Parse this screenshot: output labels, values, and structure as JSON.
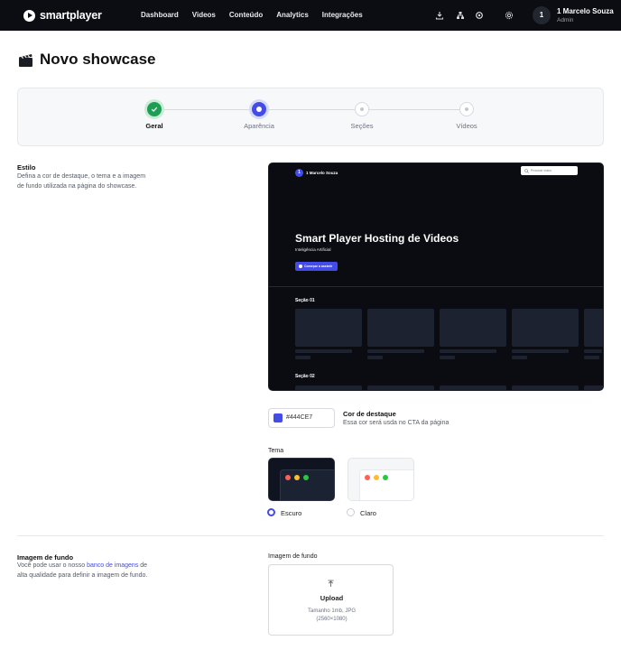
{
  "app": {
    "brand": "smartplayer",
    "nav": [
      "Dashboard",
      "Videos",
      "Conteúdo",
      "Analytics",
      "Integrações"
    ],
    "user": {
      "avatar": "1",
      "name": "1 Marcelo Souza",
      "role": "Admin"
    },
    "icons": [
      "download-icon",
      "network-icon",
      "settings-icon",
      "gear-icon"
    ]
  },
  "page": {
    "title": "Novo showcase"
  },
  "stepper": {
    "steps": [
      {
        "label": "Geral",
        "state": "done"
      },
      {
        "label": "Aparência",
        "state": "active"
      },
      {
        "label": "Seções",
        "state": "pending"
      },
      {
        "label": "Vídeos",
        "state": "pending"
      }
    ]
  },
  "estilo": {
    "title": "Estilo",
    "desc_line1": "Defina a cor de destaque, o tema e a imagem",
    "desc_line2": "de fundo utilizada na página do showcase."
  },
  "preview": {
    "badge": "1",
    "name": "1 Marcelo Souza",
    "search_placeholder": "Procurar vídeo",
    "hero_title": "Smart Player Hosting de Videos",
    "hero_subtitle": "Inteligência Artificial",
    "cta": "Começar a assistir",
    "section1": "Seção 01",
    "section2": "Seção 02"
  },
  "accent": {
    "value": "#444CE7",
    "title": "Cor de destaque",
    "desc": "Essa cor será usda no CTA da página"
  },
  "theme": {
    "title": "Tema",
    "selected": "Escuro",
    "options": [
      "Escuro",
      "Claro"
    ]
  },
  "background": {
    "title": "Imagem de fundo",
    "desc_pre": "Você pode usar o nosso ",
    "desc_link": "banco de imagens",
    "desc_post": " de",
    "desc_line2": "alta qualidade para definir a imagem de fundo.",
    "field_label": "Imagem de fundo",
    "upload_title": "Upload",
    "upload_hint1": "Tamanho 1mb, JPG",
    "upload_hint2": "(2560×1080)"
  },
  "colors": {
    "accent": "#444CE7",
    "nav_bg": "#0b0d12",
    "success": "#1f9d55",
    "traffic": [
      "#ff5f57",
      "#febc2e",
      "#28c840"
    ]
  }
}
